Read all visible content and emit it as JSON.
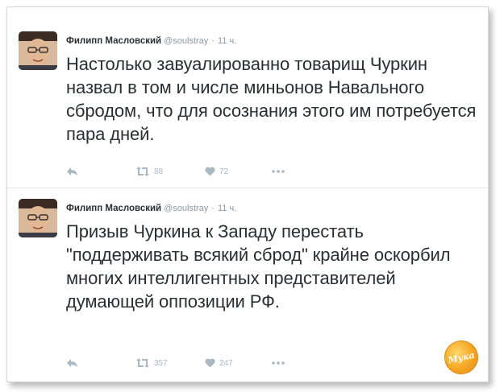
{
  "tweets": [
    {
      "author": "Филипп Масловский",
      "handle": "@soulstray",
      "separator": "·",
      "time": "11 ч.",
      "text": "Настолько завуалированно товарищ Чуркин назвал в том и числе миньонов Навального сбродом, что для осознания этого им потребуется пара дней.",
      "retweets": "88",
      "likes": "72"
    },
    {
      "author": "Филипп Масловский",
      "handle": "@soulstray",
      "separator": "·",
      "time": "11 ч.",
      "text": "Призыв Чуркина к Западу перестать \"поддерживать всякий сброд\" крайне оскорбил многих интеллигентных представителей думающей оппозиции РФ.",
      "retweets": "357",
      "likes": "247"
    }
  ],
  "watermark": "Мука",
  "icons": {
    "reply": "reply-icon",
    "retweet": "retweet-icon",
    "like": "heart-icon",
    "more": "more-dots-icon"
  },
  "colors": {
    "text": "#292f33",
    "muted": "#8899a6",
    "action": "#aab8c2",
    "watermark": "#f5a623"
  }
}
